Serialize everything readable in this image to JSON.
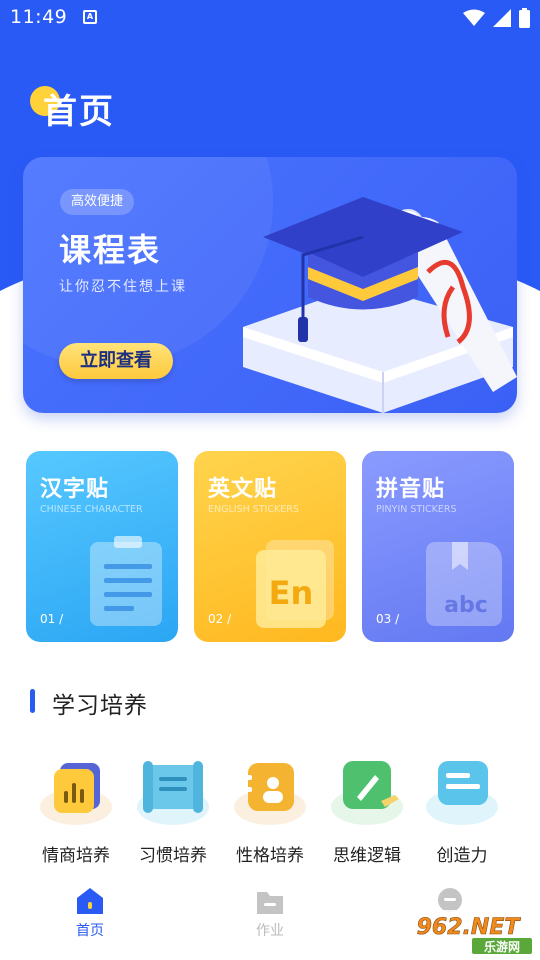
{
  "status": {
    "time": "11:49",
    "notification_letter": "A"
  },
  "header": {
    "title": "首页"
  },
  "banner": {
    "tag": "高效便捷",
    "title": "课程表",
    "subtitle": "让你忍不住想上课",
    "button_label": "立即查看"
  },
  "cards": [
    {
      "title": "汉字贴",
      "subtitle": "CHINESE CHARACTER",
      "number": "01 /",
      "icon": "receipt-icon",
      "color": "#2ba6f4"
    },
    {
      "title": "英文贴",
      "subtitle": "ENGLISH STICKERS",
      "number": "02 /",
      "icon": "en-icon",
      "icon_text": "En",
      "color": "#ffb81f"
    },
    {
      "title": "拼音贴",
      "subtitle": "PINYIN STICKERS",
      "number": "03 /",
      "icon": "abc-icon",
      "icon_text": "abc",
      "color": "#6378f2"
    }
  ],
  "section": {
    "title": "学习培养"
  },
  "features": [
    {
      "label": "情商培养",
      "icon": "chart-icon"
    },
    {
      "label": "习惯培养",
      "icon": "scroll-icon"
    },
    {
      "label": "性格培养",
      "icon": "contact-card-icon"
    },
    {
      "label": "思维逻辑",
      "icon": "pen-icon"
    },
    {
      "label": "创造力",
      "icon": "chat-bubble-icon"
    }
  ],
  "bottom_nav": {
    "items": [
      {
        "label": "首页",
        "icon": "home-icon",
        "active": true
      },
      {
        "label": "作业",
        "icon": "folder-icon",
        "active": false
      },
      {
        "label": "",
        "icon": "profile-icon",
        "active": false
      }
    ],
    "active_color": "#2a5af5",
    "inactive_color": "#bbbbbb"
  },
  "watermark": {
    "brand": "962.NET",
    "text": "乐游网"
  },
  "colors": {
    "primary": "#2a5af5",
    "accent_yellow": "#ffd23a"
  }
}
